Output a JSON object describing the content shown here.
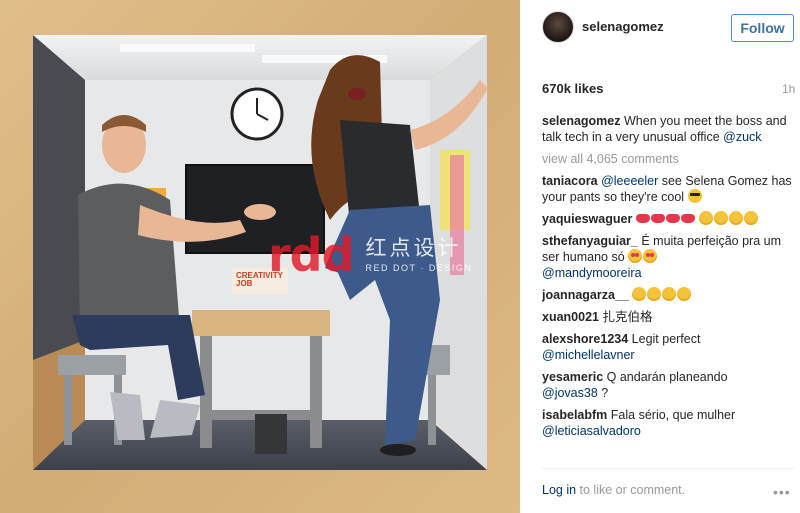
{
  "post": {
    "username": "selenagomez",
    "follow_label": "Follow",
    "likes": "670k likes",
    "time_ago": "1h",
    "caption_user": "selenagomez",
    "caption_text": " When you meet the boss and talk tech in a very unusual office ",
    "caption_mention": "@zuck",
    "view_all": "view all 4,065 comments"
  },
  "comments": [
    {
      "user": "taniacora",
      "mention": "@leeeeler",
      "text": " see Selena Gomez has your pants so they're cool",
      "emoji": [
        "sunglass"
      ]
    },
    {
      "user": "yaquieswaguer",
      "text": "",
      "emoji": [
        "kiss",
        "kiss",
        "kiss",
        "kiss",
        "face",
        "face",
        "face",
        "face"
      ]
    },
    {
      "user": "sthefanyaguiar_",
      "text": " É muita perfeição pra um ser humano só ",
      "emoji": [
        "heart-eyes",
        "heart-eyes"
      ],
      "mention2": "@mandymooreira"
    },
    {
      "user": "joannagarza__",
      "text": " ",
      "emoji": [
        "face",
        "face",
        "face",
        "face"
      ]
    },
    {
      "user": "xuan0021",
      "text": " 扎克伯格"
    },
    {
      "user": "alexshore1234",
      "text": " Legit perfect ",
      "mention2": "@michellelavner"
    },
    {
      "user": "yesameric",
      "text": " Q andarán planeando ",
      "mention2": "@jovas38",
      "after": " ?"
    },
    {
      "user": "isabelabfm",
      "text": " Fala sério, que mulher ",
      "mention2": "@leticiasalvadoro"
    }
  ],
  "footer": {
    "login_link": "Log in",
    "login_text": " to like or comment.",
    "more": "•••"
  },
  "photo": {
    "watermark_logo": "rdd",
    "watermark_cn": "红点设计",
    "watermark_en": "RED DOT · DESIGN",
    "poster_text": "CREATIVITY JOB"
  },
  "colors": {
    "follow_border": "#4e8ccd",
    "follow_text": "#3f729b",
    "link": "#003569",
    "muted": "#999999",
    "watermark_red": "#e21a28"
  },
  "icons": {
    "more": "more-options-icon"
  }
}
